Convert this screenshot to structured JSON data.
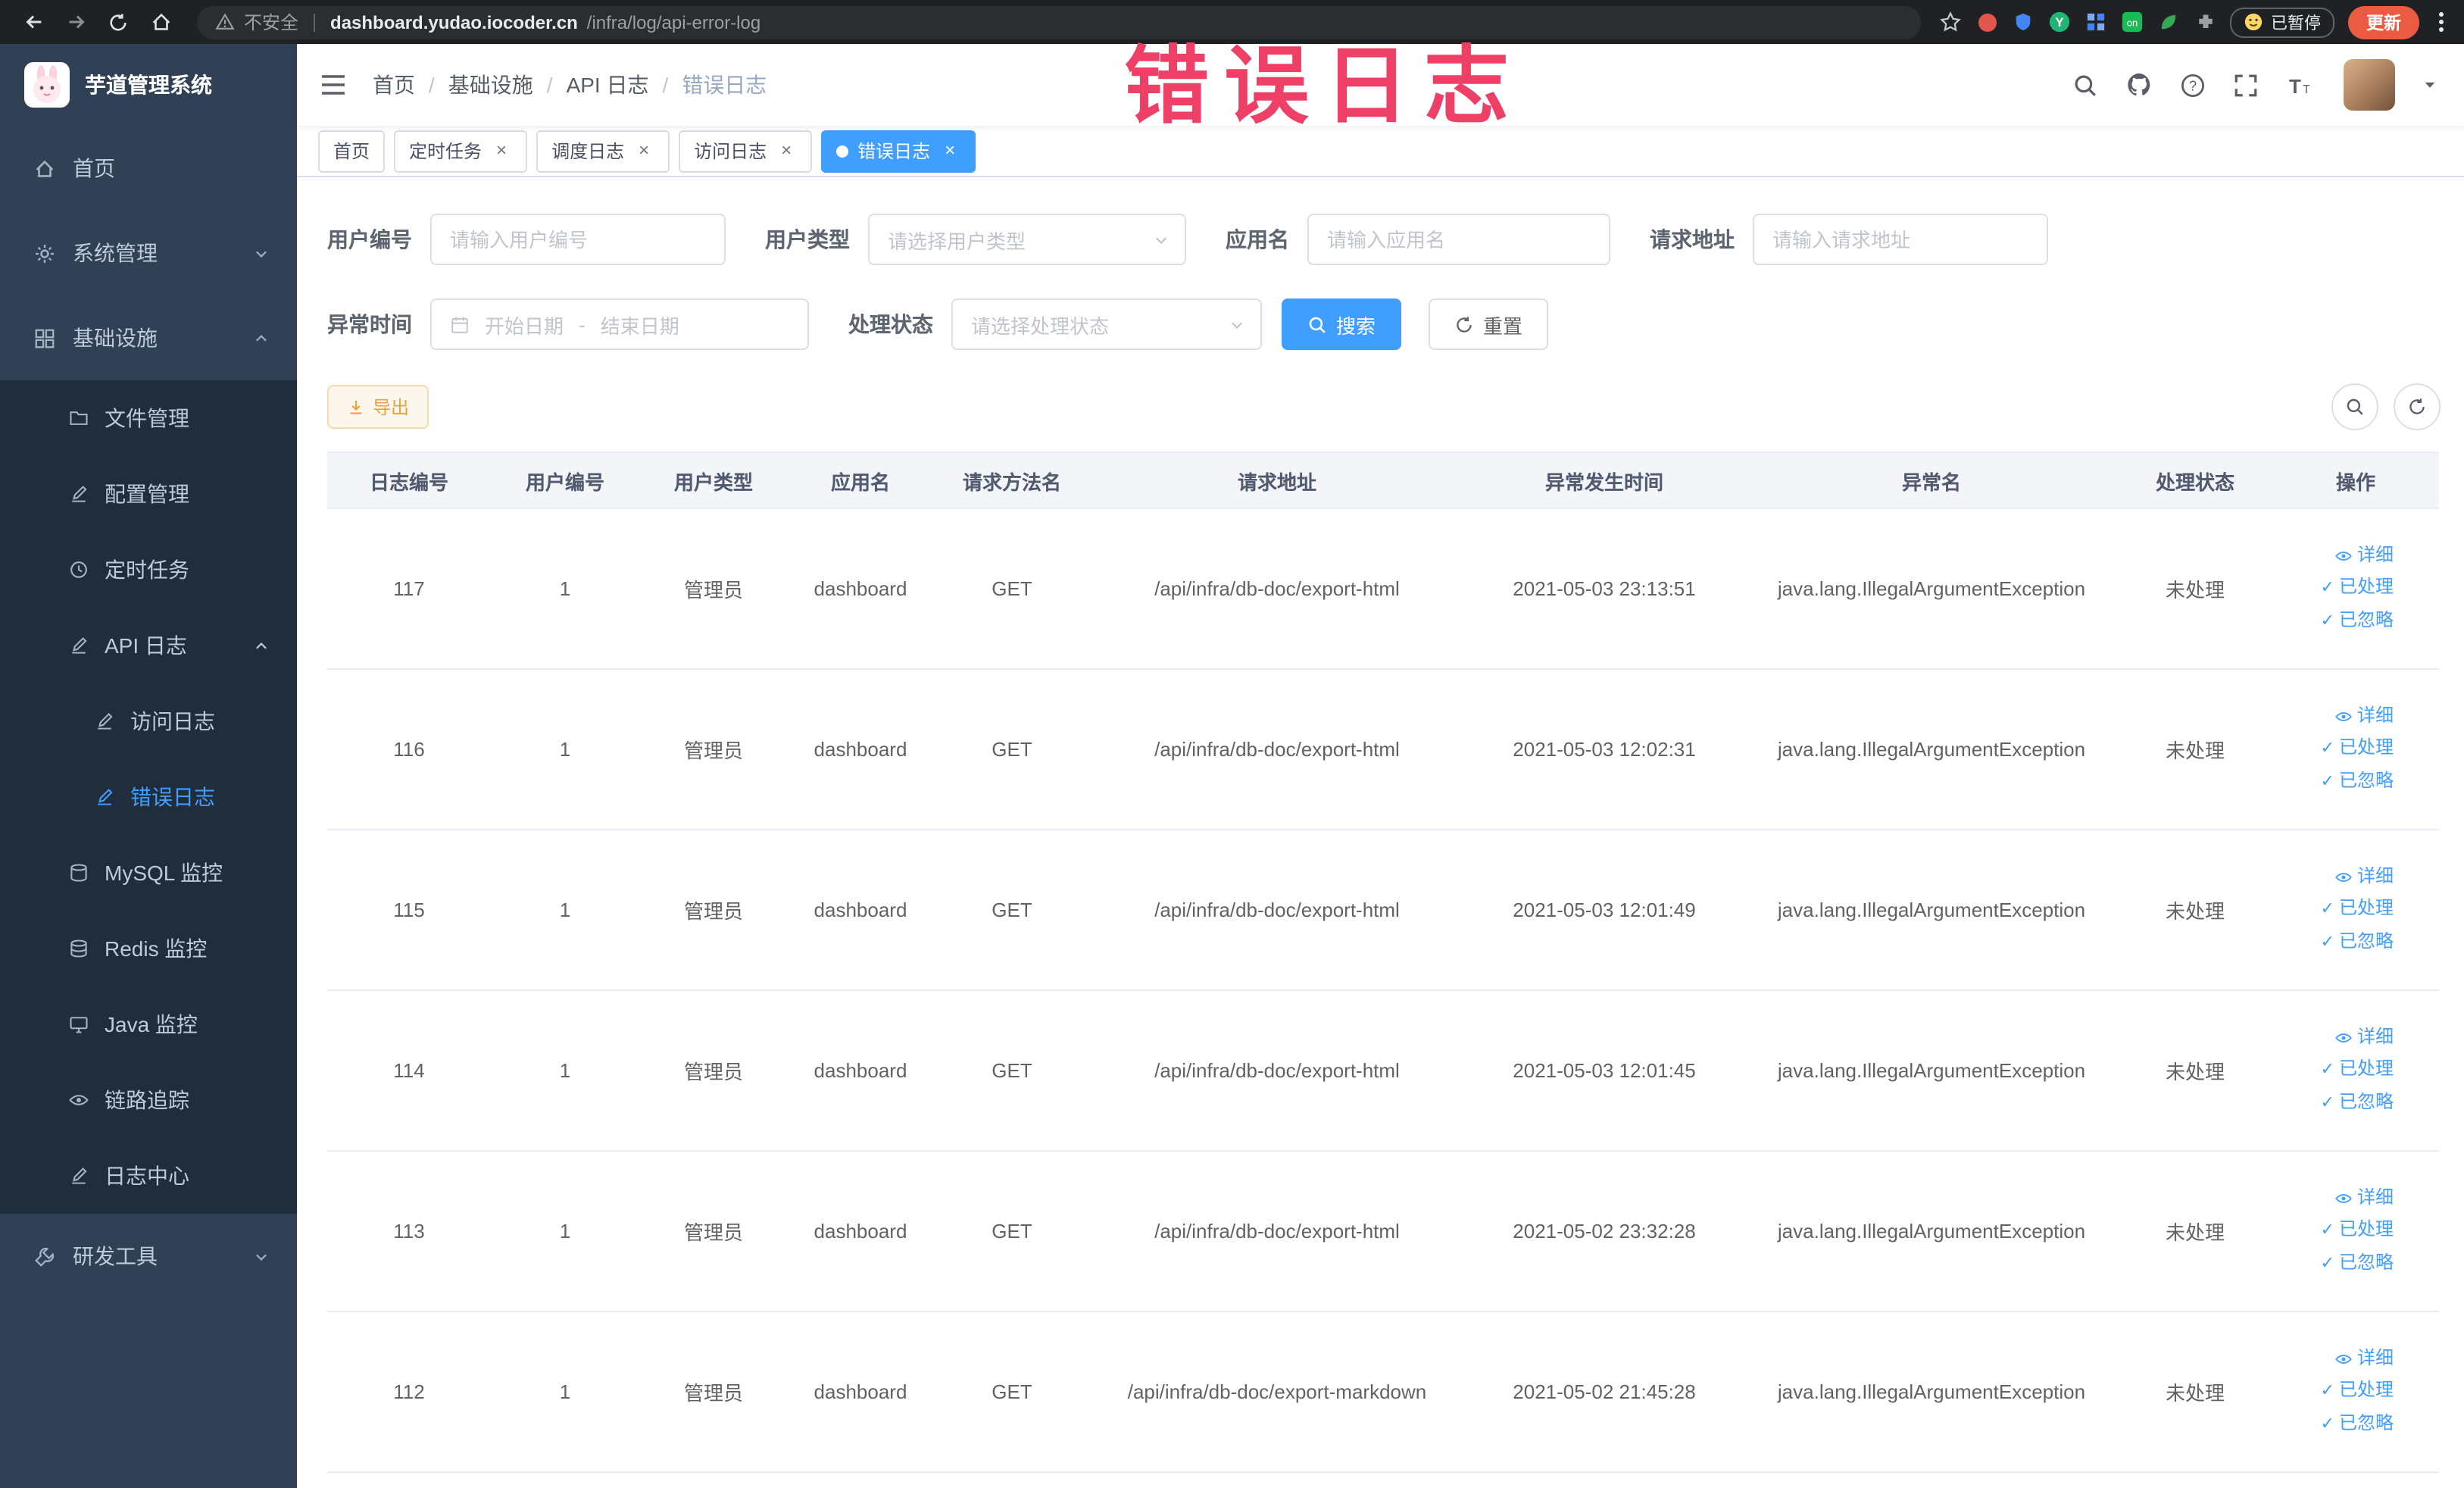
{
  "browser": {
    "security_label": "不安全",
    "url_domain": "dashboard.yudao.iocoder.cn",
    "url_path": "/infra/log/api-error-log",
    "paused_badge": "已暂停",
    "update_button": "更新"
  },
  "annotation": {
    "text": "错误日志"
  },
  "icon_glyphs": {
    "close": "×",
    "check": "✓",
    "breadcrumb_separator": "/"
  },
  "sidebar": {
    "logo_title": "芋道管理系统",
    "menu": [
      {
        "label": "首页"
      },
      {
        "label": "系统管理"
      },
      {
        "label": "基础设施",
        "children": [
          {
            "label": "文件管理"
          },
          {
            "label": "配置管理"
          },
          {
            "label": "定时任务"
          },
          {
            "label": "API 日志",
            "children": [
              {
                "label": "访问日志"
              },
              {
                "label": "错误日志"
              }
            ]
          },
          {
            "label": "MySQL 监控"
          },
          {
            "label": "Redis 监控"
          },
          {
            "label": "Java 监控"
          },
          {
            "label": "链路追踪"
          },
          {
            "label": "日志中心"
          }
        ]
      },
      {
        "label": "研发工具"
      }
    ]
  },
  "header": {
    "breadcrumb": [
      {
        "label": "首页"
      },
      {
        "label": "基础设施"
      },
      {
        "label": "API 日志"
      },
      {
        "label": "错误日志"
      }
    ]
  },
  "tabs": [
    {
      "label": "首页"
    },
    {
      "label": "定时任务"
    },
    {
      "label": "调度日志"
    },
    {
      "label": "访问日志"
    },
    {
      "label": "错误日志"
    }
  ],
  "filters": {
    "user_id": {
      "label": "用户编号",
      "placeholder": "请输入用户编号"
    },
    "user_type": {
      "label": "用户类型",
      "placeholder": "请选择用户类型"
    },
    "app_name": {
      "label": "应用名",
      "placeholder": "请输入应用名"
    },
    "request_url": {
      "label": "请求地址",
      "placeholder": "请输入请求地址"
    },
    "exception_time": {
      "label": "异常时间",
      "start_placeholder": "开始日期",
      "separator": "-",
      "end_placeholder": "结束日期"
    },
    "process_status": {
      "label": "处理状态",
      "placeholder": "请选择处理状态"
    },
    "search_label": "搜索",
    "reset_label": "重置"
  },
  "toolbar": {
    "export_label": "导出"
  },
  "table": {
    "headers": [
      "日志编号",
      "用户编号",
      "用户类型",
      "应用名",
      "请求方法名",
      "请求地址",
      "异常发生时间",
      "异常名",
      "处理状态",
      "操作"
    ],
    "action_labels": [
      "详细",
      "已处理",
      "已忽略"
    ],
    "rows": [
      {
        "id": "117",
        "user_id": "1",
        "user_type": "管理员",
        "app_name": "dashboard",
        "method": "GET",
        "url": "/api/infra/db-doc/export-html",
        "time": "2021-05-03 23:13:51",
        "exception": "java.lang.IllegalArgumentException",
        "status": "未处理"
      },
      {
        "id": "116",
        "user_id": "1",
        "user_type": "管理员",
        "app_name": "dashboard",
        "method": "GET",
        "url": "/api/infra/db-doc/export-html",
        "time": "2021-05-03 12:02:31",
        "exception": "java.lang.IllegalArgumentException",
        "status": "未处理"
      },
      {
        "id": "115",
        "user_id": "1",
        "user_type": "管理员",
        "app_name": "dashboard",
        "method": "GET",
        "url": "/api/infra/db-doc/export-html",
        "time": "2021-05-03 12:01:49",
        "exception": "java.lang.IllegalArgumentException",
        "status": "未处理"
      },
      {
        "id": "114",
        "user_id": "1",
        "user_type": "管理员",
        "app_name": "dashboard",
        "method": "GET",
        "url": "/api/infra/db-doc/export-html",
        "time": "2021-05-03 12:01:45",
        "exception": "java.lang.IllegalArgumentException",
        "status": "未处理"
      },
      {
        "id": "113",
        "user_id": "1",
        "user_type": "管理员",
        "app_name": "dashboard",
        "method": "GET",
        "url": "/api/infra/db-doc/export-html",
        "time": "2021-05-02 23:32:28",
        "exception": "java.lang.IllegalArgumentException",
        "status": "未处理"
      },
      {
        "id": "112",
        "user_id": "1",
        "user_type": "管理员",
        "app_name": "dashboard",
        "method": "GET",
        "url": "/api/infra/db-doc/export-markdown",
        "time": "2021-05-02 21:45:28",
        "exception": "java.lang.IllegalArgumentException",
        "status": "未处理"
      }
    ]
  }
}
